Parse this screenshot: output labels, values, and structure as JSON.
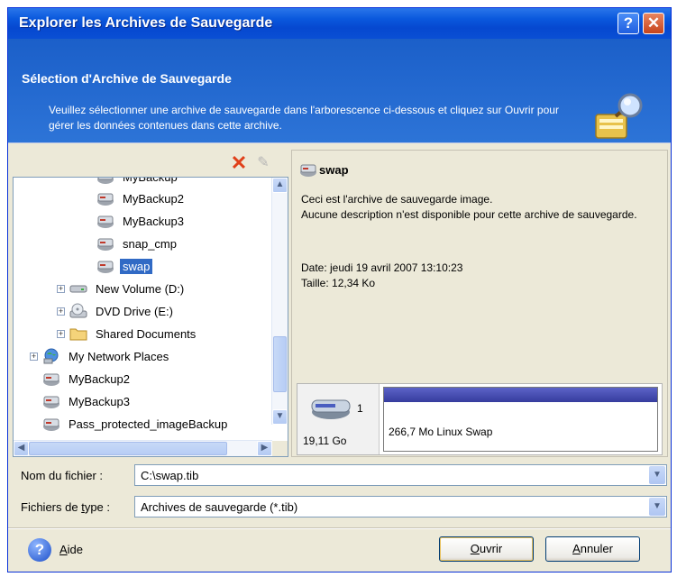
{
  "window": {
    "title": "Explorer les Archives de Sauvegarde",
    "help_symbol": "?",
    "close_symbol": "✕"
  },
  "header": {
    "title": "Sélection d'Archive de Sauvegarde",
    "description": "Veuillez sélectionner une archive de sauvegarde dans l'arborescence ci-dessous et cliquez sur Ouvrir pour gérer les données contenues dans cette archive.",
    "icon": "magnifier-wand-icon"
  },
  "toolbar": {
    "delete_icon": "✕",
    "edit_icon": "✎"
  },
  "tree": {
    "items": [
      {
        "label": "MyBackup",
        "icon": "archive-icon"
      },
      {
        "label": "MyBackup2",
        "icon": "archive-icon"
      },
      {
        "label": "MyBackup3",
        "icon": "archive-icon"
      },
      {
        "label": "snap_cmp",
        "icon": "archive-icon"
      },
      {
        "label": "swap",
        "icon": "archive-icon",
        "selected": true
      },
      {
        "label": "New Volume (D:)",
        "icon": "drive-icon"
      },
      {
        "label": "DVD Drive (E:)",
        "icon": "dvd-drive-icon"
      },
      {
        "label": "Shared Documents",
        "icon": "folder-icon"
      },
      {
        "label": "My Network Places",
        "icon": "network-places-icon"
      },
      {
        "label": "MyBackup2",
        "icon": "archive-icon"
      },
      {
        "label": "MyBackup3",
        "icon": "archive-icon"
      },
      {
        "label": "Pass_protected_imageBackup",
        "icon": "archive-icon"
      }
    ],
    "expander": "+",
    "scroll_up": "▲",
    "scroll_down": "▼",
    "scroll_left": "◀",
    "scroll_right": "▶"
  },
  "details": {
    "name": "swap",
    "line1": "Ceci est l'archive de sauvegarde image.",
    "line2": "Aucune description n'est disponible pour cette archive de sauvegarde.",
    "date": "Date: jeudi 19 avril 2007 13:10:23",
    "size": "Taille: 12,34 Ko",
    "disk_number": "1",
    "disk_size": "19,11 Go",
    "partition_label": "266,7 Mo  Linux Swap",
    "partition_color": "#4a50b5"
  },
  "form": {
    "filename_label": "Nom du fichier :",
    "filename_value": "C:\\swap.tib",
    "filetype_label_pre": "Fichiers de ",
    "filetype_label_accel": "t",
    "filetype_label_post": "ype :",
    "filetype_value": "Archives de sauvegarde (*.tib)",
    "arrow": "▼"
  },
  "footer": {
    "help_symbol": "?",
    "help_accel": "A",
    "help_rest": "ide",
    "open_accel": "O",
    "open_rest": "uvrir",
    "cancel_accel": "A",
    "cancel_rest": "nnuler"
  },
  "colors": {
    "titlebar": "#0a58dd",
    "header": "#2568d2",
    "selection": "#316ac5"
  }
}
